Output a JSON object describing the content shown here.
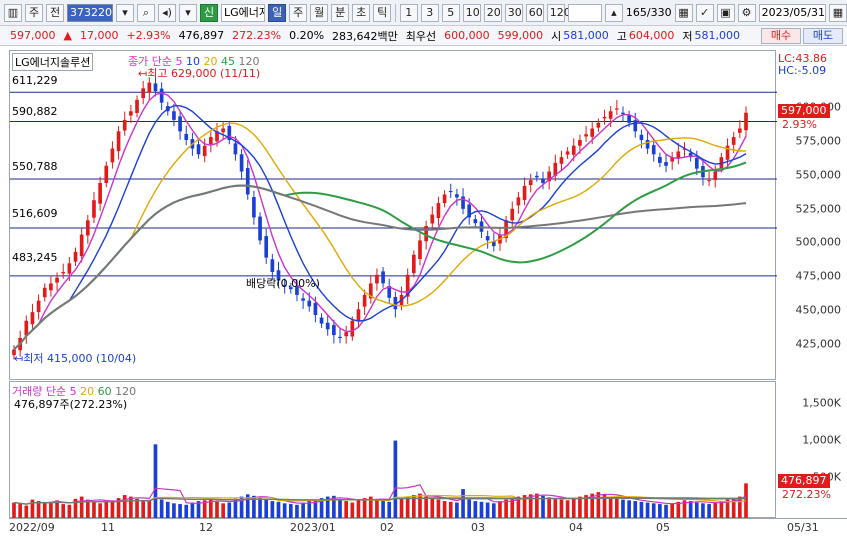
{
  "toolbar": {
    "code": "373220",
    "name": "LG에너지솔",
    "tab_sin": "신",
    "tab_day": "일",
    "tab_week": "주",
    "tab_month": "월",
    "tab_min": "분",
    "tab_tick": "초",
    "tab_tick2": "틱",
    "periods": [
      "1",
      "3",
      "5",
      "10",
      "20",
      "30",
      "60",
      "120"
    ],
    "count": "165",
    "count_total": "/330",
    "date": "2023/05/31",
    "jeon": "전",
    "ju": "주"
  },
  "info": {
    "price": "597,000",
    "change_arrow": "▲",
    "change": "17,000",
    "change_pct": "+2.93%",
    "volume": "476,897",
    "volume_pct": "272.23%",
    "turnover": "0.20%",
    "amount": "283,642백만",
    "best_ask_label": "최우선",
    "best_ask": "600,000",
    "best_bid": "599,000",
    "open_label": "시",
    "open": "581,000",
    "high_label": "고",
    "high": "604,000",
    "low_label": "저",
    "low": "581,000",
    "buy": "매수",
    "sell": "매도"
  },
  "price_pane": {
    "title": "LG에너지솔루션",
    "legend_prefix": "종가 단순",
    "ma": [
      "5",
      "10",
      "20",
      "45",
      "120"
    ],
    "lc": "LC:43.86",
    "hc": "HC:-5.09",
    "hi_label": "최고 629,000 (11/11)",
    "lo_label": "최저 415,000 (10/04)",
    "dividend": "배당락(0.00%)",
    "hlines": [
      "611,229",
      "590,882",
      "550,788",
      "516,609",
      "483,245"
    ],
    "current_tag": "597,000",
    "current_pct": "2.93%",
    "yticks": [
      "600,000",
      "575,000",
      "550,000",
      "525,000",
      "500,000",
      "475,000",
      "450,000",
      "425,000"
    ]
  },
  "vol_pane": {
    "legend_prefix": "거래량 단순",
    "ma": [
      "5",
      "20",
      "60",
      "120"
    ],
    "value": "476,897주(272.23%)",
    "yticks": [
      "1,500K",
      "1,000K",
      "500K"
    ],
    "tag": "476,897",
    "tag_pct": "272.23%"
  },
  "xaxis": [
    "2022/09",
    "11",
    "12",
    "2023/01",
    "02",
    "03",
    "04",
    "05"
  ],
  "xaxis_right": "05/31",
  "colors": {
    "up": "#e01b1b",
    "down": "#1b3fd4",
    "ma5": "#cc33cc",
    "ma10": "#1b3fd4",
    "ma20": "#e0a800",
    "ma45": "#2f9c45",
    "ma120": "#777777"
  },
  "chart_data": {
    "type": "candlestick",
    "ylim": [
      410000,
      640000
    ],
    "closes": [
      432000,
      440000,
      452000,
      458000,
      466000,
      475000,
      478000,
      482000,
      486000,
      492000,
      500000,
      512000,
      522000,
      536000,
      548000,
      560000,
      572000,
      584000,
      592000,
      598000,
      606000,
      614000,
      618000,
      612000,
      604000,
      598000,
      592000,
      584000,
      578000,
      572000,
      568000,
      574000,
      580000,
      584000,
      586000,
      578000,
      568000,
      556000,
      540000,
      524000,
      508000,
      496000,
      486000,
      480000,
      476000,
      474000,
      470000,
      466000,
      462000,
      456000,
      450000,
      446000,
      442000,
      440000,
      444000,
      452000,
      460000,
      470000,
      478000,
      484000,
      478000,
      468000,
      460000,
      470000,
      484000,
      498000,
      508000,
      518000,
      526000,
      534000,
      540000,
      542000,
      538000,
      530000,
      524000,
      520000,
      514000,
      508000,
      504000,
      512000,
      522000,
      530000,
      538000,
      546000,
      550000,
      552000,
      548000,
      556000,
      562000,
      566000,
      570000,
      574000,
      578000,
      582000,
      586000,
      590000,
      594000,
      598000,
      600000,
      596000,
      590000,
      584000,
      578000,
      572000,
      568000,
      562000,
      560000,
      566000,
      570000,
      572000,
      566000,
      558000,
      552000,
      550000,
      556000,
      566000,
      574000,
      580000,
      586000,
      597000
    ],
    "volume_k": [
      220,
      200,
      180,
      260,
      240,
      210,
      230,
      250,
      200,
      190,
      270,
      300,
      260,
      240,
      210,
      230,
      250,
      280,
      320,
      300,
      270,
      240,
      250,
      1000,
      260,
      230,
      210,
      200,
      190,
      220,
      240,
      250,
      260,
      230,
      210,
      220,
      270,
      300,
      330,
      310,
      280,
      260,
      240,
      230,
      210,
      200,
      190,
      220,
      240,
      260,
      280,
      300,
      310,
      260,
      240,
      220,
      250,
      280,
      300,
      260,
      240,
      230,
      1050,
      280,
      300,
      320,
      340,
      300,
      280,
      260,
      240,
      230,
      220,
      400,
      260,
      240,
      230,
      220,
      210,
      240,
      260,
      280,
      300,
      320,
      330,
      340,
      310,
      290,
      270,
      260,
      250,
      280,
      300,
      320,
      340,
      360,
      330,
      300,
      280,
      260,
      250,
      240,
      230,
      220,
      210,
      200,
      190,
      210,
      230,
      250,
      240,
      220,
      210,
      200,
      220,
      240,
      260,
      280,
      300,
      477
    ]
  }
}
